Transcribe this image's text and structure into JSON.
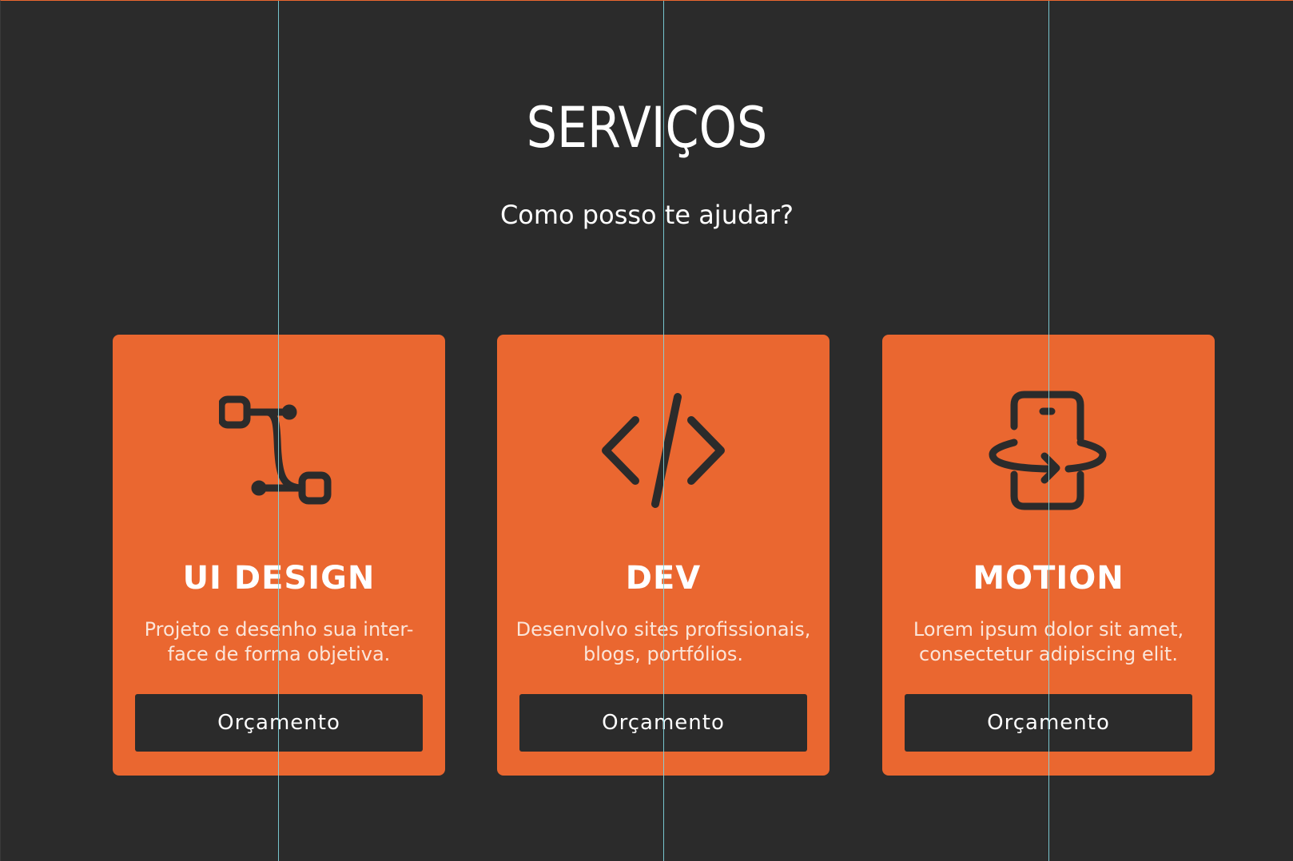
{
  "header": {
    "title": "SERVIÇOS",
    "subtitle": "Como posso te ajudar?"
  },
  "cards": [
    {
      "icon": "bezier-curve-icon",
      "title": "UI DESIGN",
      "description": "Projeto e desenho sua inter-face de forma objetiva.",
      "button_label": "Orçamento"
    },
    {
      "icon": "code-icon",
      "title": "DEV",
      "description": "Desenvolvo sites profissionais, blogs, portfólios.",
      "button_label": "Orçamento"
    },
    {
      "icon": "phone-rotate-icon",
      "title": "MOTION",
      "description": "Lorem ipsum dolor sit amet, consectetur adipiscing elit.",
      "button_label": "Orçamento"
    }
  ],
  "colors": {
    "background": "#2b2b2b",
    "accent": "#ea6730",
    "text": "#ffffff",
    "guide": "#7fd6e0"
  }
}
